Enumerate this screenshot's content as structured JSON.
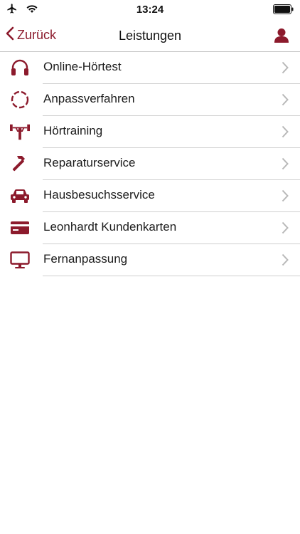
{
  "status_bar": {
    "time": "13:24"
  },
  "nav": {
    "back_label": "Zurück",
    "title": "Leistungen"
  },
  "services": [
    {
      "label": "Online-Hörtest",
      "icon": "headphones-icon"
    },
    {
      "label": "Anpassverfahren",
      "icon": "dashed-circle-icon"
    },
    {
      "label": "Hörtraining",
      "icon": "weightlifter-icon"
    },
    {
      "label": "Reparaturservice",
      "icon": "hammer-icon"
    },
    {
      "label": "Hausbesuchsservice",
      "icon": "car-icon"
    },
    {
      "label": "Leonhardt Kundenkarten",
      "icon": "credit-card-icon"
    },
    {
      "label": "Fernanpassung",
      "icon": "monitor-icon"
    }
  ],
  "colors": {
    "accent": "#8c1a2c",
    "divider": "#cfcfcf",
    "chevron": "#b8b8b8"
  }
}
